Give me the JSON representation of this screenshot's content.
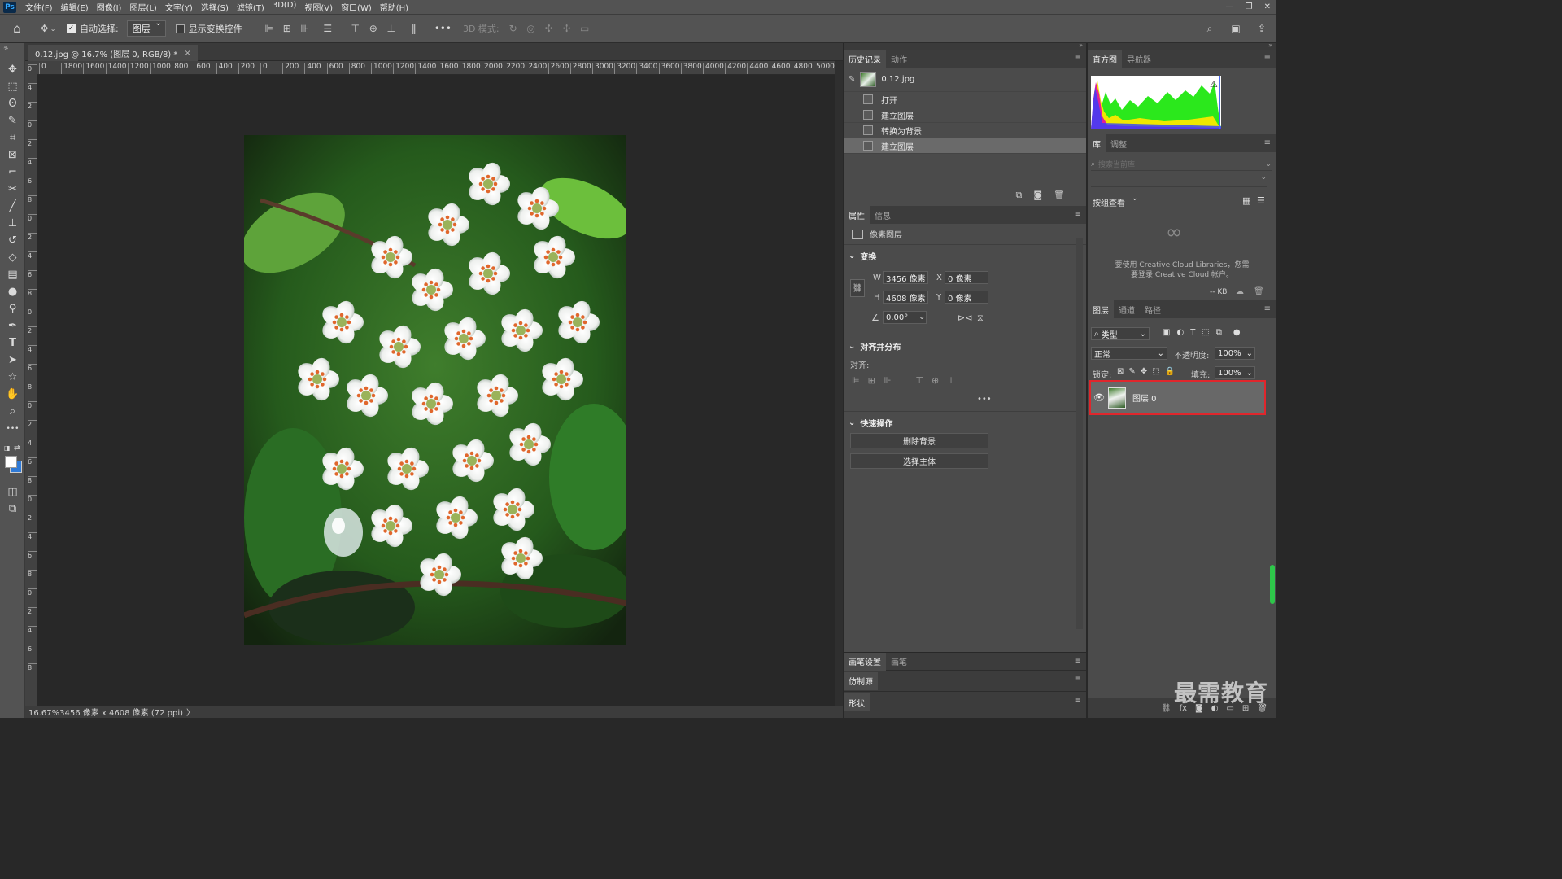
{
  "app": {
    "logo": "Ps",
    "accent": "#31a8ff"
  },
  "menu": [
    "文件(F)",
    "编辑(E)",
    "图像(I)",
    "图层(L)",
    "文字(Y)",
    "选择(S)",
    "滤镜(T)",
    "3D(D)",
    "视图(V)",
    "窗口(W)",
    "帮助(H)"
  ],
  "window_controls": [
    "—",
    "❐",
    "✕"
  ],
  "options": {
    "auto_select_label": "自动选择:",
    "auto_select_value": "图层",
    "show_transform_label": "显示变换控件",
    "mode_3d_label": "3D 模式:",
    "more": "•••"
  },
  "tools": [
    "move-tool",
    "marquee-tool",
    "lasso-tool",
    "quick-select-tool",
    "crop-tool",
    "frame-tool",
    "eyedropper-tool",
    "healing-tool",
    "brush-tool",
    "stamp-tool",
    "history-brush-tool",
    "eraser-tool",
    "gradient-tool",
    "blur-tool",
    "dodge-tool",
    "pen-tool",
    "type-tool",
    "path-select-tool",
    "shape-tool",
    "hand-tool",
    "zoom-tool",
    "more-tools"
  ],
  "document": {
    "tab_title": "0.12.jpg @ 16.7% (图层 0, RGB/8) *",
    "close": "×"
  },
  "ruler_h": [
    "0",
    "1800",
    "1600",
    "1400",
    "1200",
    "1000",
    "800",
    "600",
    "400",
    "200",
    "0",
    "200",
    "400",
    "600",
    "800",
    "1000",
    "1200",
    "1400",
    "1600",
    "1800",
    "2000",
    "2200",
    "2400",
    "2600",
    "2800",
    "3000",
    "3200",
    "3400",
    "3600",
    "3800",
    "4000",
    "4200",
    "4400",
    "4600",
    "4800",
    "5000",
    "52"
  ],
  "ruler_v": [
    "0",
    "4",
    "2",
    "0",
    "2",
    "4",
    "6",
    "8",
    "0",
    "2",
    "4",
    "6",
    "8",
    "0",
    "2",
    "4",
    "6",
    "8",
    "0",
    "2",
    "4",
    "6",
    "8",
    "0",
    "2",
    "4",
    "6",
    "8",
    "0",
    "2",
    "4",
    "6",
    "8"
  ],
  "status": "16.67%3456 像素 x 4608 像素 (72 ppi)",
  "history": {
    "tabs": [
      "历史记录",
      "动作"
    ],
    "snapshot": "0.12.jpg",
    "items": [
      "打开",
      "建立图层",
      "转换为背景",
      "建立图层"
    ],
    "active_index": 3
  },
  "properties": {
    "tabs": [
      "属性",
      "信息"
    ],
    "type_label": "像素图层",
    "transform_title": "变换",
    "w_label": "W",
    "w_value": "3456 像素",
    "x_label": "X",
    "x_value": "0 像素",
    "h_label": "H",
    "h_value": "4608 像素",
    "y_label": "Y",
    "y_value": "0 像素",
    "angle_value": "0.00°",
    "align_title": "对齐并分布",
    "align_label": "对齐:",
    "align_more": "•••",
    "quick_title": "快速操作",
    "remove_bg": "删除背景",
    "select_subject": "选择主体"
  },
  "bottom_panels": [
    {
      "tabs": [
        "画笔设置",
        "画笔"
      ]
    },
    {
      "tabs": [
        "仿制源"
      ]
    },
    {
      "tabs": [
        "形状"
      ]
    }
  ],
  "histogram": {
    "tabs": [
      "直方图",
      "导航器"
    ],
    "warning": "⚠"
  },
  "library": {
    "tabs": [
      "库",
      "调整"
    ],
    "search_placeholder": "搜索当前库",
    "group_by": "按组查看",
    "message": "要使用 Creative Cloud Libraries，您需要登录 Creative Cloud 帐户。",
    "size": "-- KB"
  },
  "layers": {
    "tabs": [
      "图层",
      "通道",
      "路径"
    ],
    "filter_kind": "类型",
    "blend_mode": "正常",
    "opacity_label": "不透明度:",
    "opacity_value": "100%",
    "lock_label": "锁定:",
    "fill_label": "填充:",
    "fill_value": "100%",
    "items": [
      {
        "name": "图层 0",
        "visible": true,
        "selected": true
      }
    ],
    "highlight_color": "#e0262c"
  },
  "watermark": "最需教育"
}
